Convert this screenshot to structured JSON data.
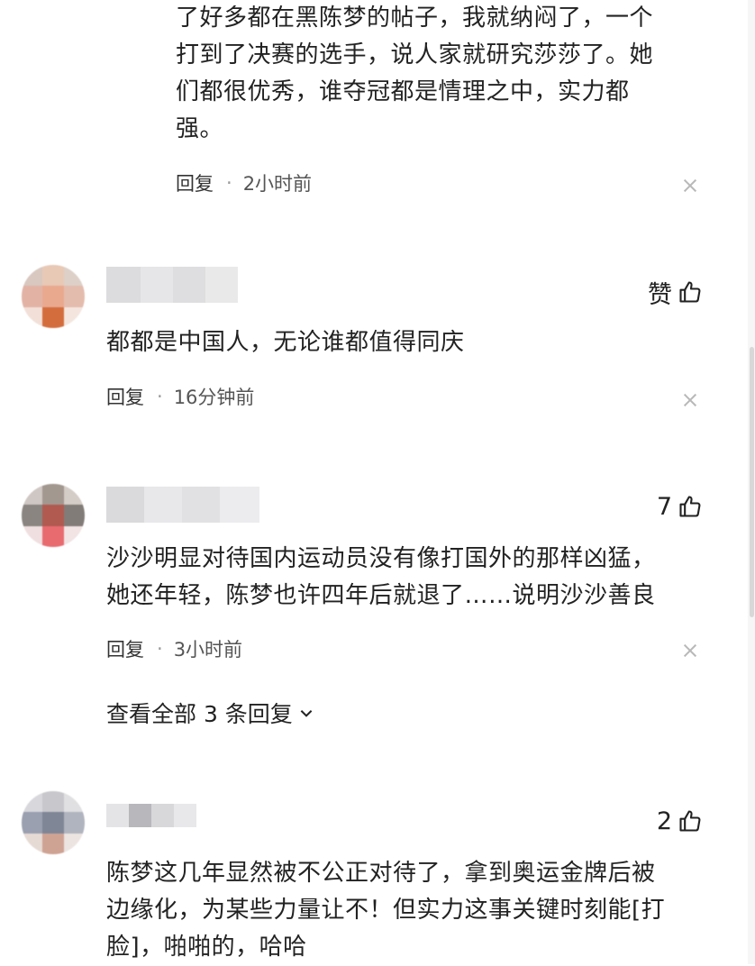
{
  "comments_top": {
    "text_lines": [
      "了好多都在黑陈梦的帖子，我就纳闷了，一个",
      "打到了决赛的选手，说人家就研究莎莎了。她",
      "们都很优秀，谁夺冠都是情理之中，实力都",
      "强。"
    ],
    "reply_label": "回复",
    "time": "2小时前"
  },
  "comments": [
    {
      "like": "赞",
      "text_lines": [
        "都都是中国人，无论谁都值得同庆"
      ],
      "reply_label": "回复",
      "time": "16分钟前"
    },
    {
      "like": "7",
      "text_lines": [
        "沙沙明显对待国内运动员没有像打国外的那样凶猛，",
        "她还年轻，陈梦也许四年后就退了……说明沙沙善良"
      ],
      "reply_label": "回复",
      "time": "3小时前",
      "view_replies": "查看全部 3 条回复"
    },
    {
      "like": "2",
      "text_lines": [
        "陈梦这几年显然被不公正对待了，拿到奥运金牌后被",
        "边缘化，为某些力量让不！但实力这事关键时刻能[打",
        "脸]，啪啪的，哈哈"
      ]
    }
  ],
  "separator": "·",
  "icons": {
    "like": "thumbs-up-icon",
    "close": "close-icon",
    "expand": "chevron-down-icon"
  },
  "colors": {
    "text": "#222222",
    "meta": "#555555",
    "close": "#b8b8b8"
  }
}
